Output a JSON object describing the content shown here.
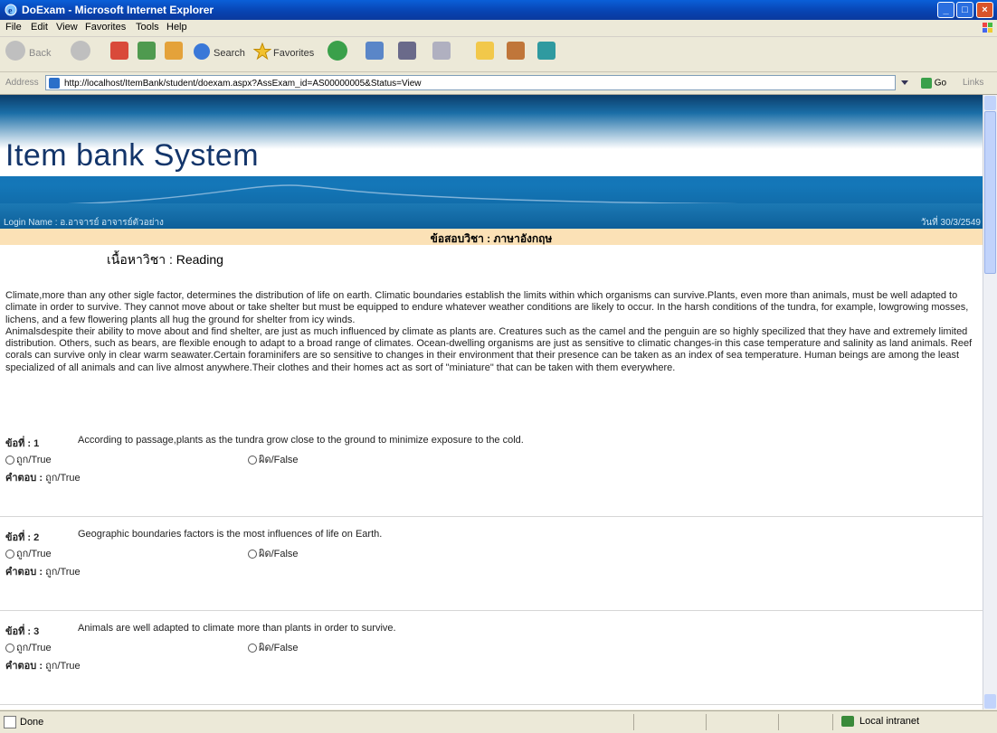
{
  "window": {
    "title": "DoExam - Microsoft Internet Explorer",
    "buttons": {
      "minimize": "_",
      "maximize": "□",
      "close": "×"
    }
  },
  "menu": [
    "File",
    "Edit",
    "View",
    "Favorites",
    "Tools",
    "Help"
  ],
  "toolbar": {
    "back": "Back",
    "search": "Search",
    "favorites": "Favorites"
  },
  "address": {
    "label": "Address",
    "url": "http://localhost/ItemBank/student/doexam.aspx?AssExam_id=AS00000005&Status=View",
    "go": "Go",
    "links": "Links"
  },
  "page": {
    "brand": "Item bank System",
    "login_name": "Login Name : อ.อาจารย์ อาจารย์ตัวอย่าง",
    "date": "วันที่ 30/3/2549",
    "subject_label": "ข้อสอบวิชา : ภาษาอังกฤษ",
    "content_label": "เนื้อหาวิชา : Reading",
    "passage": [
      "Climate,more than any other sigle factor, determines the distribution of life on earth. Climatic boundaries establish the limits within which organisms can survive.Plants, even more than animals, must be well adapted to climate in order to survive. They cannot move about or take shelter but must be equipped to endure whatever weather conditions are likely to occur. In the harsh conditions of the tundra, for example, lowgrowing mosses, lichens, and a few flowering plants all hug the ground for shelter from icy winds.",
      "Animalsdespite their ability to move about and find shelter, are just as much influenced by climate as plants are. Creatures such as the camel and the penguin are so highly specilized that they have and extremely limited distribution. Others, such as bears, are flexible enough to adapt to a broad range of climates. Ocean-dwelling organisms are just as sensitive to climatic changes-in this case temperature and salinity as land animals. Reef corals can survive only in clear warm seawater.Certain foraminifers are so sensitive to changes in their environment that their presence can be taken as an index of sea temperature. Human beings are among the least specialized of all animals and can live almost anywhere.Their clothes and their homes act as sort of \"miniature\" that can be taken with them everywhere."
    ],
    "questions": [
      {
        "num": "ข้อที่ : 1",
        "text": "According to passage,plants as the tundra grow close to the ground to minimize exposure to the cold.",
        "opt_true": "ถูก/True",
        "opt_false": "ผิด/False",
        "answer_label": "คำตอบ :",
        "answer": "ถูก/True"
      },
      {
        "num": "ข้อที่ : 2",
        "text": "Geographic boundaries factors is the most influences of life on Earth.",
        "opt_true": "ถูก/True",
        "opt_false": "ผิด/False",
        "answer_label": "คำตอบ :",
        "answer": "ถูก/True"
      },
      {
        "num": "ข้อที่ : 3",
        "text": "Animals are well adapted to climate more than plants in order to survive.",
        "opt_true": "ถูก/True",
        "opt_false": "ผิด/False",
        "answer_label": "คำตอบ :",
        "answer": "ถูก/True"
      }
    ]
  },
  "status": {
    "text": "Done",
    "zone": "Local intranet"
  }
}
